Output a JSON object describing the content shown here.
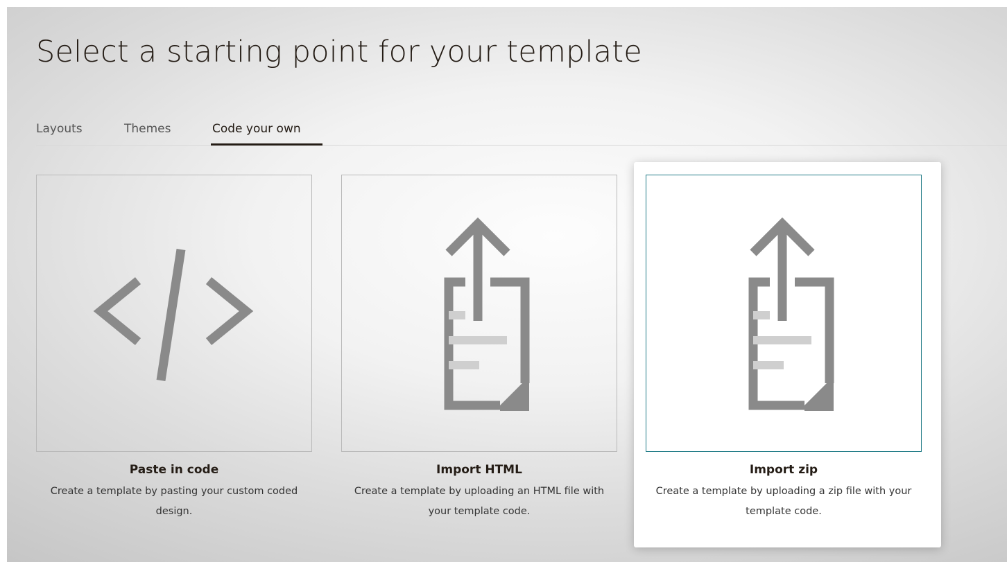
{
  "page": {
    "title": "Select a starting point for your template"
  },
  "tabs": [
    {
      "label": "Layouts",
      "active": false
    },
    {
      "label": "Themes",
      "active": false
    },
    {
      "label": "Code your own",
      "active": true
    }
  ],
  "cards": [
    {
      "title": "Paste in code",
      "description": "Create a template by pasting your custom coded design.",
      "icon": "code-brackets-icon",
      "selected": false
    },
    {
      "title": "Import HTML",
      "description": "Create a template by uploading an HTML file with your template code.",
      "icon": "file-upload-icon",
      "selected": false
    },
    {
      "title": "Import zip",
      "description": "Create a template by uploading a zip file with your template code.",
      "icon": "file-upload-icon",
      "selected": true
    }
  ],
  "colors": {
    "text": "#241c15",
    "icon": "#8a8a8a",
    "icon_light": "#cfcfcf",
    "selected_border": "#1f7a86"
  }
}
